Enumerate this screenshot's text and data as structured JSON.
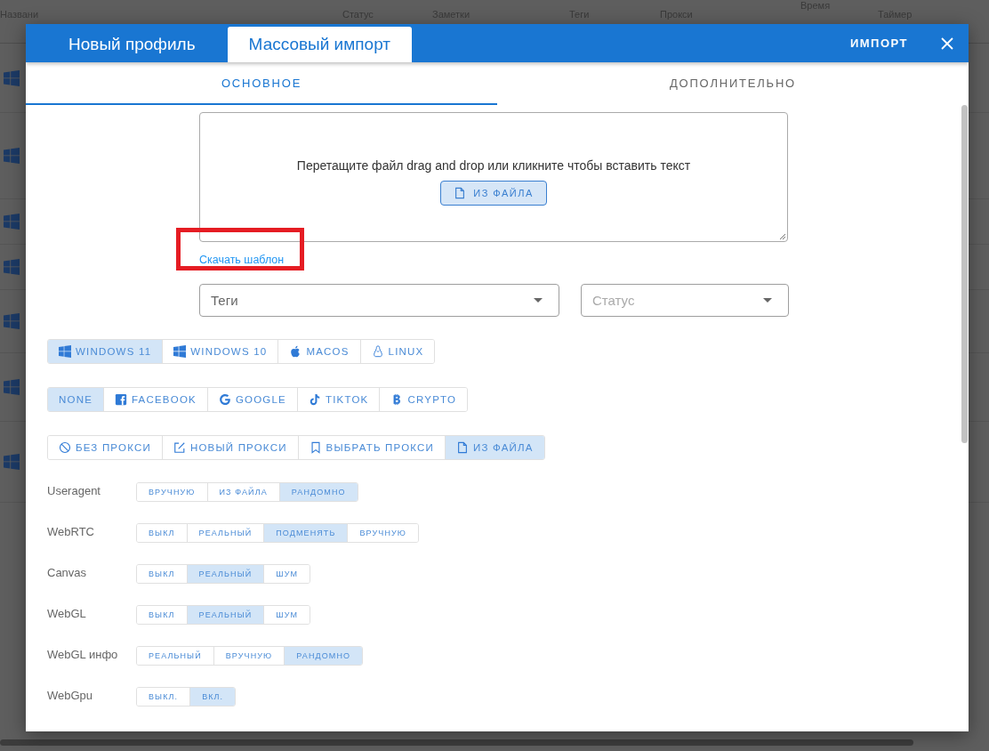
{
  "background": {
    "columns": [
      "Названи",
      "Статус",
      "Заметки",
      "Теги",
      "Прокси",
      "Время",
      "Таймер"
    ],
    "rows": [
      {
        "kind": "windows"
      },
      {
        "kind": "windows"
      },
      {
        "kind": "windows"
      },
      {
        "kind": "windows"
      },
      {
        "kind": "windows"
      },
      {
        "kind": "windows"
      },
      {
        "kind": "windows"
      }
    ]
  },
  "modal": {
    "tabs": [
      {
        "label": "Новый профиль",
        "selected": false
      },
      {
        "label": "Массовый импорт",
        "selected": true
      }
    ],
    "action": "ИМПОРТ",
    "subtabs": [
      {
        "label": "ОСНОВНОЕ",
        "selected": true
      },
      {
        "label": "ДОПОЛНИТЕЛЬНО",
        "selected": false
      }
    ],
    "dropzone": {
      "text": "Перетащите файл drag and drop или кликните чтобы вставить текст",
      "button": "ИЗ ФАЙЛА"
    },
    "template_link": {
      "label": "Скачать шаблон",
      "highlighted": true
    },
    "selects": [
      {
        "placeholder": "Теги"
      },
      {
        "placeholder": "Статус"
      }
    ],
    "groups": [
      [
        {
          "label": "WINDOWS 11",
          "kind": "windows",
          "selected": true
        },
        {
          "label": "WINDOWS 10",
          "kind": "windows",
          "selected": false
        },
        {
          "label": "MACOS",
          "kind": "apple",
          "selected": false
        },
        {
          "label": "LINUX",
          "kind": "linux",
          "selected": false
        }
      ],
      [
        {
          "label": "NONE",
          "kind": "none",
          "selected": true
        },
        {
          "label": "FACEBOOK",
          "kind": "facebook",
          "selected": false
        },
        {
          "label": "GOOGLE",
          "kind": "google",
          "selected": false
        },
        {
          "label": "TIKTOK",
          "kind": "tiktok",
          "selected": false
        },
        {
          "label": "CRYPTO",
          "kind": "bitcoin",
          "selected": false
        }
      ],
      [
        {
          "label": "БЕЗ ПРОКСИ",
          "kind": "ban",
          "selected": false
        },
        {
          "label": "НОВЫЙ ПРОКСИ",
          "kind": "edit",
          "selected": false
        },
        {
          "label": "ВЫБРАТЬ ПРОКСИ",
          "kind": "bookmark",
          "selected": false
        },
        {
          "label": "ИЗ ФАЙЛА",
          "kind": "file",
          "selected": true
        }
      ]
    ],
    "settings": [
      {
        "label": "Useragent",
        "options": [
          {
            "label": "ВРУЧНУЮ",
            "selected": false
          },
          {
            "label": "ИЗ ФАЙЛА",
            "selected": false
          },
          {
            "label": "РАНДОМНО",
            "selected": true
          }
        ]
      },
      {
        "label": "WebRTC",
        "options": [
          {
            "label": "ВЫКЛ",
            "selected": false
          },
          {
            "label": "РЕАЛЬНЫЙ",
            "selected": false
          },
          {
            "label": "ПОДМЕНЯТЬ",
            "selected": true
          },
          {
            "label": "ВРУЧНУЮ",
            "selected": false
          }
        ]
      },
      {
        "label": "Canvas",
        "options": [
          {
            "label": "ВЫКЛ",
            "selected": false
          },
          {
            "label": "РЕАЛЬНЫЙ",
            "selected": true
          },
          {
            "label": "ШУМ",
            "selected": false
          }
        ]
      },
      {
        "label": "WebGL",
        "options": [
          {
            "label": "ВЫКЛ",
            "selected": false
          },
          {
            "label": "РЕАЛЬНЫЙ",
            "selected": true
          },
          {
            "label": "ШУМ",
            "selected": false
          }
        ]
      },
      {
        "label": "WebGL инфо",
        "options": [
          {
            "label": "РЕАЛЬНЫЙ",
            "selected": false
          },
          {
            "label": "ВРУЧНУЮ",
            "selected": false
          },
          {
            "label": "РАНДОМНО",
            "selected": true
          }
        ]
      },
      {
        "label": "WebGpu",
        "options": [
          {
            "label": "ВЫКЛ.",
            "selected": false
          },
          {
            "label": "ВКЛ.",
            "selected": true
          }
        ]
      }
    ]
  }
}
